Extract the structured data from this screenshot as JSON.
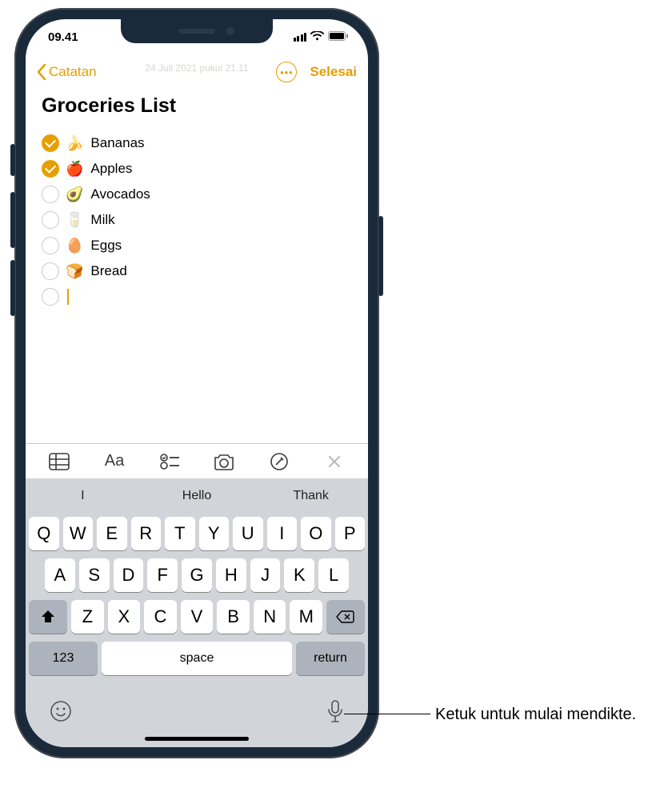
{
  "status": {
    "time": "09.41"
  },
  "nav": {
    "back_label": "Catatan",
    "timestamp": "24 Juli 2021 pukul 21.11",
    "done_label": "Selesai"
  },
  "note": {
    "title": "Groceries List",
    "items": [
      {
        "emoji": "🍌",
        "label": "Bananas",
        "checked": true
      },
      {
        "emoji": "🍎",
        "label": "Apples",
        "checked": true
      },
      {
        "emoji": "🥑",
        "label": "Avocados",
        "checked": false
      },
      {
        "emoji": "🥛",
        "label": "Milk",
        "checked": false
      },
      {
        "emoji": "🥚",
        "label": "Eggs",
        "checked": false
      },
      {
        "emoji": "🍞",
        "label": "Bread",
        "checked": false
      }
    ]
  },
  "suggestions": {
    "s1": "I",
    "s2": "Hello",
    "s3": "Thank"
  },
  "keyboard": {
    "row1": [
      "Q",
      "W",
      "E",
      "R",
      "T",
      "Y",
      "U",
      "I",
      "O",
      "P"
    ],
    "row2": [
      "A",
      "S",
      "D",
      "F",
      "G",
      "H",
      "J",
      "K",
      "L"
    ],
    "row3": [
      "Z",
      "X",
      "C",
      "V",
      "B",
      "N",
      "M"
    ],
    "numKey": "123",
    "space": "space",
    "return": "return"
  },
  "callout": {
    "text": "Ketuk untuk mulai mendikte."
  }
}
